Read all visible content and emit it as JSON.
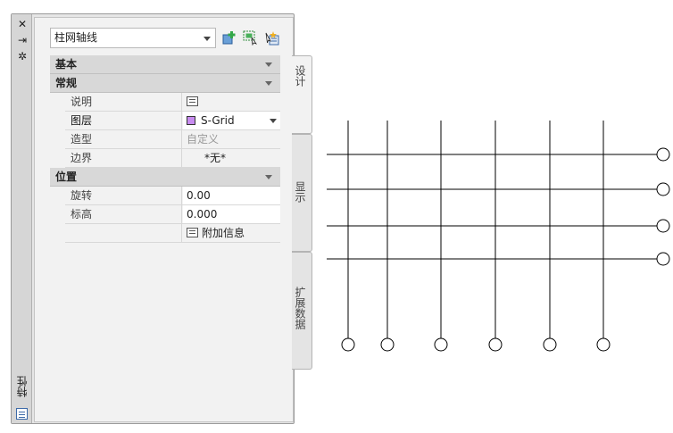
{
  "palette": {
    "title": "特性",
    "close_glyph": "✕",
    "pin_glyph": "⇥",
    "settings_glyph": "✲"
  },
  "style": {
    "selected": "柱网轴线"
  },
  "tabs": [
    {
      "label": "设计"
    },
    {
      "label": "显示"
    },
    {
      "label": "扩展数据"
    }
  ],
  "categories": {
    "basic": "基本",
    "general": "常规",
    "location": "位置"
  },
  "general_rows": [
    {
      "name": "说明",
      "value": ""
    },
    {
      "name": "图层",
      "value": "S-Grid"
    },
    {
      "name": "造型",
      "value": "自定义"
    },
    {
      "name": "边界",
      "value": "*无*"
    }
  ],
  "location_rows": [
    {
      "name": "旋转",
      "value": "0.00"
    },
    {
      "name": "标高",
      "value": "0.000"
    },
    {
      "name": "",
      "value": "附加信息"
    }
  ],
  "colors": {
    "layer_swatch": "#c88cf0",
    "grid_line": "#000000"
  }
}
